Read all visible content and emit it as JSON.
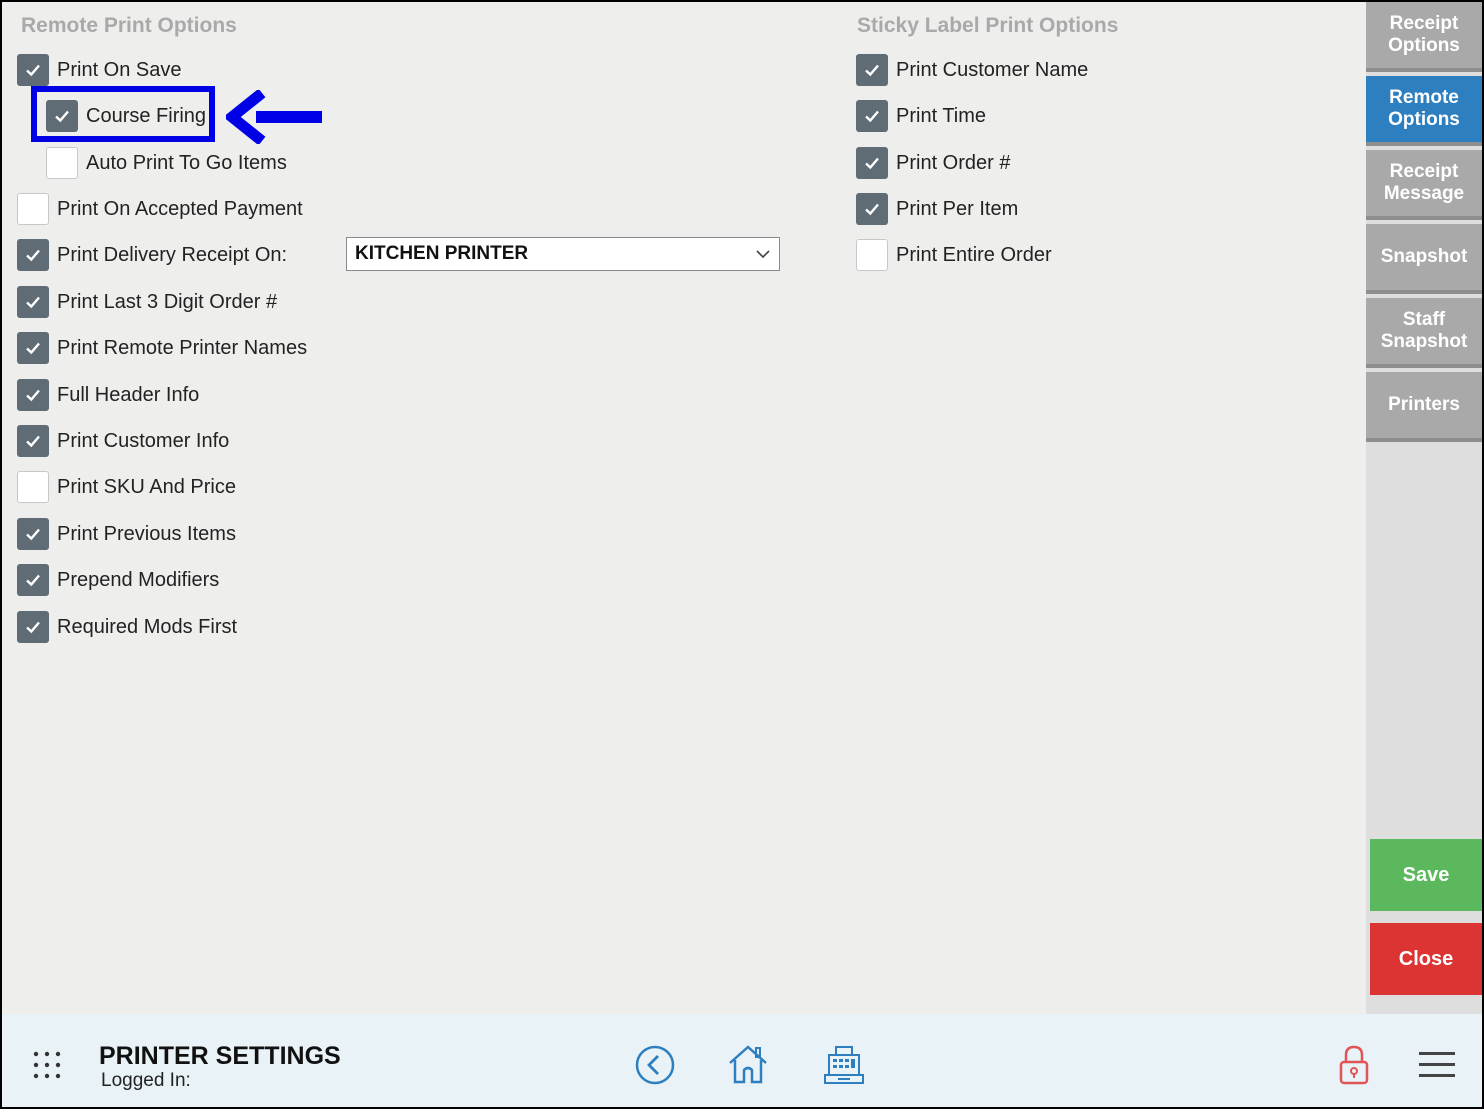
{
  "remote": {
    "title": "Remote Print Options",
    "options": [
      {
        "label": "Print On Save",
        "checked": true
      },
      {
        "label": "Course Firing",
        "checked": true
      },
      {
        "label": "Auto Print To Go Items",
        "checked": false
      },
      {
        "label": "Print On Accepted Payment",
        "checked": false
      },
      {
        "label": "Print Delivery Receipt On:",
        "checked": true
      },
      {
        "label": "Print Last 3 Digit Order #",
        "checked": true
      },
      {
        "label": "Print Remote Printer Names",
        "checked": true
      },
      {
        "label": "Full Header Info",
        "checked": true
      },
      {
        "label": "Print Customer Info",
        "checked": true
      },
      {
        "label": "Print SKU And Price",
        "checked": false
      },
      {
        "label": "Print Previous Items",
        "checked": true
      },
      {
        "label": "Prepend Modifiers",
        "checked": true
      },
      {
        "label": "Required Mods First",
        "checked": true
      }
    ],
    "delivery_printer": "KITCHEN PRINTER"
  },
  "sticky": {
    "title": "Sticky Label Print Options",
    "options": [
      {
        "label": "Print Customer Name",
        "checked": true
      },
      {
        "label": "Print Time",
        "checked": true
      },
      {
        "label": "Print Order #",
        "checked": true
      },
      {
        "label": "Print Per Item",
        "checked": true
      },
      {
        "label": "Print Entire Order",
        "checked": false
      }
    ]
  },
  "sidebar": {
    "tabs": [
      {
        "line1": "Receipt",
        "line2": "Options",
        "active": false
      },
      {
        "line1": "Remote",
        "line2": "Options",
        "active": true
      },
      {
        "line1": "Receipt",
        "line2": "Message",
        "active": false
      },
      {
        "line1": "Snapshot",
        "line2": "",
        "active": false
      },
      {
        "line1": "Staff",
        "line2": "Snapshot",
        "active": false
      },
      {
        "line1": "Printers",
        "line2": "",
        "active": false
      }
    ],
    "save_label": "Save",
    "close_label": "Close"
  },
  "footer": {
    "title": "PRINTER SETTINGS",
    "subtitle": "Logged In:",
    "icons": [
      "grid-menu-icon",
      "back-icon",
      "home-icon",
      "register-icon",
      "lock-icon",
      "hamburger-menu-icon"
    ]
  },
  "colors": {
    "accent": "#2d7fbf",
    "save": "#5cb85c",
    "close": "#dc3333",
    "highlight": "#0000e6",
    "checkbox_on": "#5f6b75"
  }
}
